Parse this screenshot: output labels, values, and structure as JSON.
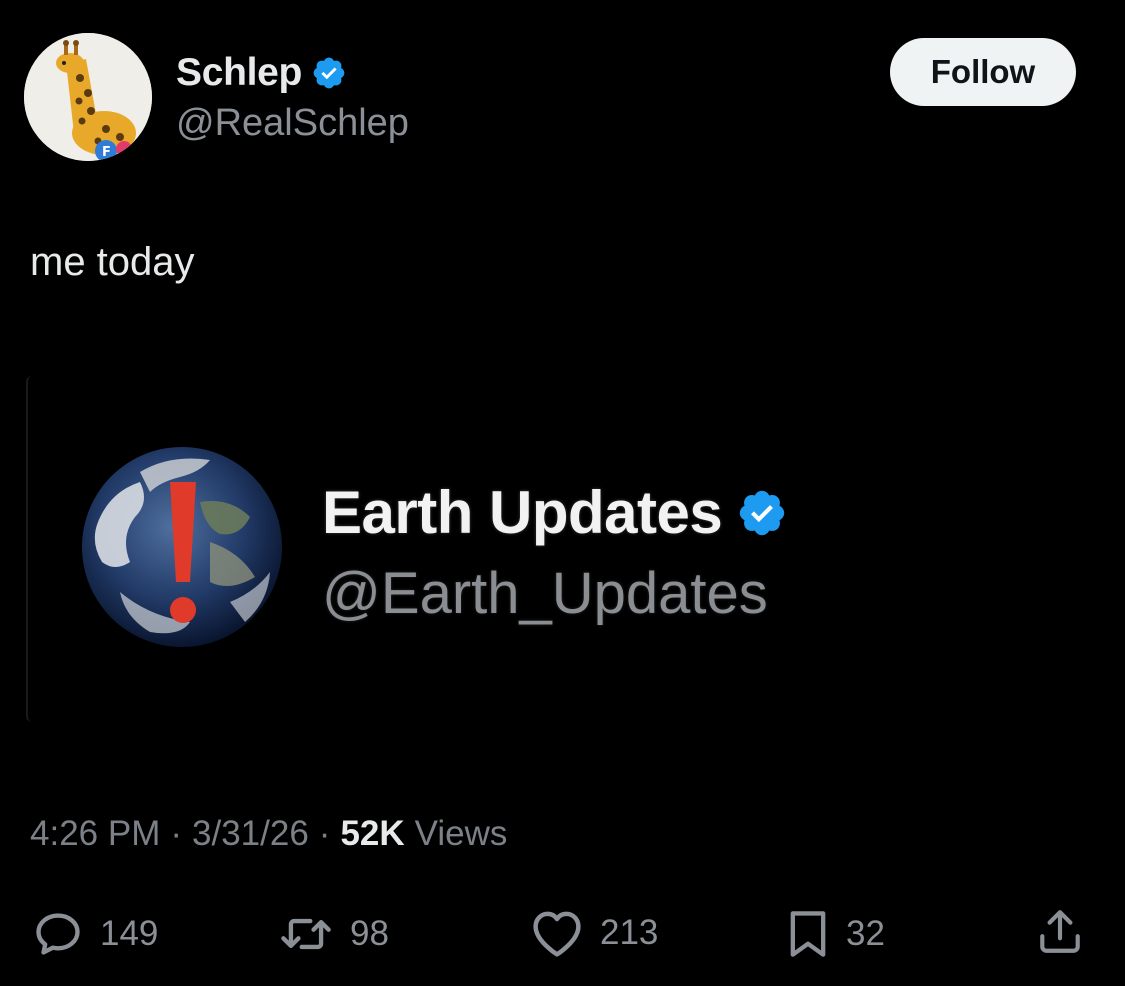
{
  "author": {
    "display_name": "Schlep",
    "handle": "@RealSchlep",
    "avatar_icon": "giraffe-avatar-icon",
    "verified_icon": "verified-badge-icon"
  },
  "follow_label": "Follow",
  "tweet_text": "me today",
  "media": {
    "account_name": "Earth Updates",
    "account_handle": "@Earth_Updates",
    "avatar_icon": "earth-with-exclamation-icon"
  },
  "meta": {
    "time": "4:26 PM",
    "separator": "·",
    "date": "3/31/26",
    "views_count": "52K",
    "views_label": "Views"
  },
  "actions": {
    "replies": "149",
    "reposts": "98",
    "likes": "213",
    "bookmarks": "32"
  },
  "colors": {
    "background": "#000000",
    "verified_blue": "#1d9bf0",
    "follow_button_bg": "#eff3f4",
    "muted_text": "#8b9096"
  }
}
